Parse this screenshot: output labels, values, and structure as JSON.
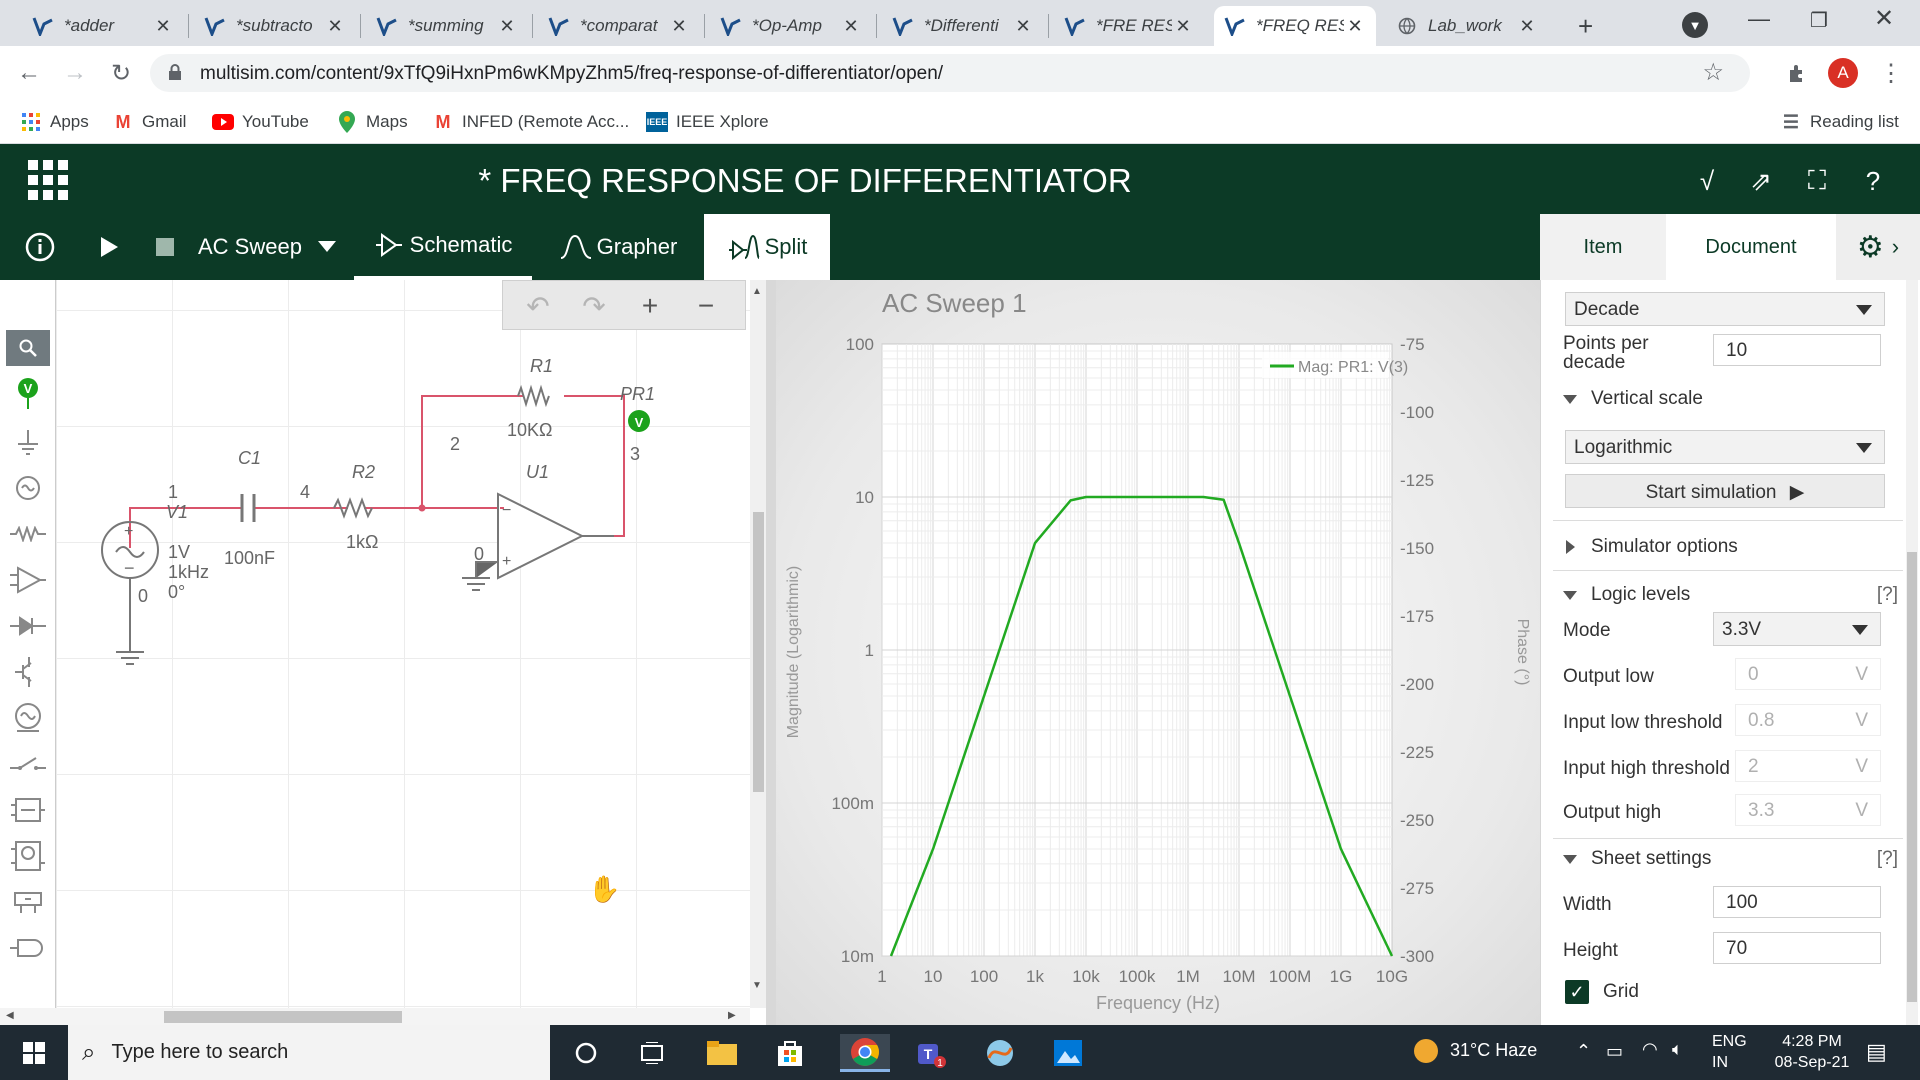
{
  "browser": {
    "tabs": [
      {
        "title": "*adder"
      },
      {
        "title": "*subtracto"
      },
      {
        "title": "*summing"
      },
      {
        "title": "*comparat"
      },
      {
        "title": "*Op-Amp"
      },
      {
        "title": "*Differenti"
      },
      {
        "title": "*FRE RES C"
      },
      {
        "title": "*FREQ RES"
      },
      {
        "title": "Lab_work"
      }
    ],
    "url": "multisim.com/content/9xTfQ9iHxnPm6wKMpyZhm5/freq-response-of-differentiator/open/",
    "profile_initial": "A",
    "bookmarks": [
      "Apps",
      "Gmail",
      "YouTube",
      "Maps",
      "INFED (Remote Acc...",
      "IEEE Xplore"
    ],
    "reading_list": "Reading list"
  },
  "app": {
    "title": "* FREQ RESPONSE OF DIFFERENTIATOR",
    "analysis": "AC Sweep",
    "tabs": {
      "schematic": "Schematic",
      "grapher": "Grapher",
      "split": "Split"
    },
    "panel_tabs": {
      "item": "Item",
      "document": "Document"
    }
  },
  "schematic": {
    "labels": {
      "r1": "R1",
      "r1_val": "10KΩ",
      "pr1": "PR1",
      "c1": "C1",
      "c1_val": "100nF",
      "r2": "R2",
      "r2_val": "1kΩ",
      "u1": "U1",
      "v1": "V1",
      "v1_amp": "1V",
      "v1_freq": "1kHz",
      "v1_phase": "0°",
      "n1": "1",
      "n2": "2",
      "n3": "3",
      "n4": "4",
      "n0a": "0",
      "n0b": "0",
      "probe": "V"
    }
  },
  "grapher": {
    "title": "AC Sweep 1",
    "legend": "Mag: PR1: V(3)",
    "xlabel": "Frequency (Hz)",
    "ylabel": "Magnitude (Logarithmic)",
    "y2label": "Phase (°)",
    "xticks": [
      "1",
      "10",
      "100",
      "1k",
      "10k",
      "100k",
      "1M",
      "10M",
      "100M",
      "1G",
      "10G"
    ],
    "yticks": [
      "100",
      "10",
      "1",
      "100m",
      "10m"
    ],
    "y2ticks": [
      "-75",
      "-100",
      "-125",
      "-150",
      "-175",
      "-200",
      "-225",
      "-250",
      "-275",
      "-300"
    ]
  },
  "chart_data": {
    "type": "line",
    "title": "AC Sweep 1",
    "xlabel": "Frequency (Hz)",
    "ylabel": "Magnitude (Logarithmic)",
    "x_scale": "log",
    "y_scale": "log",
    "xlim": [
      1,
      10000000000
    ],
    "ylim": [
      0.01,
      100
    ],
    "y2lim": [
      -300,
      -75
    ],
    "grid": true,
    "legend_position": "top-right",
    "series": [
      {
        "name": "Mag: PR1: V(3)",
        "color": "#22aa22",
        "x": [
          1.5,
          10,
          100,
          1000,
          5000,
          10000,
          20000,
          100000,
          1000000,
          2000000,
          5000000,
          10000000,
          100000000,
          1000000000,
          10000000000
        ],
        "y": [
          0.01,
          0.05,
          0.5,
          5,
          9.5,
          10,
          10,
          10,
          10,
          10,
          9.6,
          5,
          0.5,
          0.05,
          0.01
        ]
      }
    ]
  },
  "panel": {
    "decade_select": "Decade",
    "points_label": "Points per decade",
    "points_value": "10",
    "vscale_label": "Vertical scale",
    "vscale_select": "Logarithmic",
    "start_sim": "Start simulation",
    "sim_options": "Simulator options",
    "logic_levels": "Logic levels",
    "help": "[?]",
    "mode_label": "Mode",
    "mode_value": "3.3V",
    "out_low_label": "Output low",
    "out_low_value": "0",
    "in_low_label": "Input low threshold",
    "in_low_value": "0.8",
    "in_high_label": "Input high threshold",
    "in_high_value": "2",
    "out_high_label": "Output high",
    "out_high_value": "3.3",
    "unit": "V",
    "sheet_settings": "Sheet settings",
    "width_label": "Width",
    "width_value": "100",
    "height_label": "Height",
    "height_value": "70",
    "grid_label": "Grid"
  },
  "taskbar": {
    "search_placeholder": "Type here to search",
    "weather": "31°C  Haze",
    "lang1": "ENG",
    "lang2": "IN",
    "time": "4:28 PM",
    "date": "08-Sep-21"
  }
}
